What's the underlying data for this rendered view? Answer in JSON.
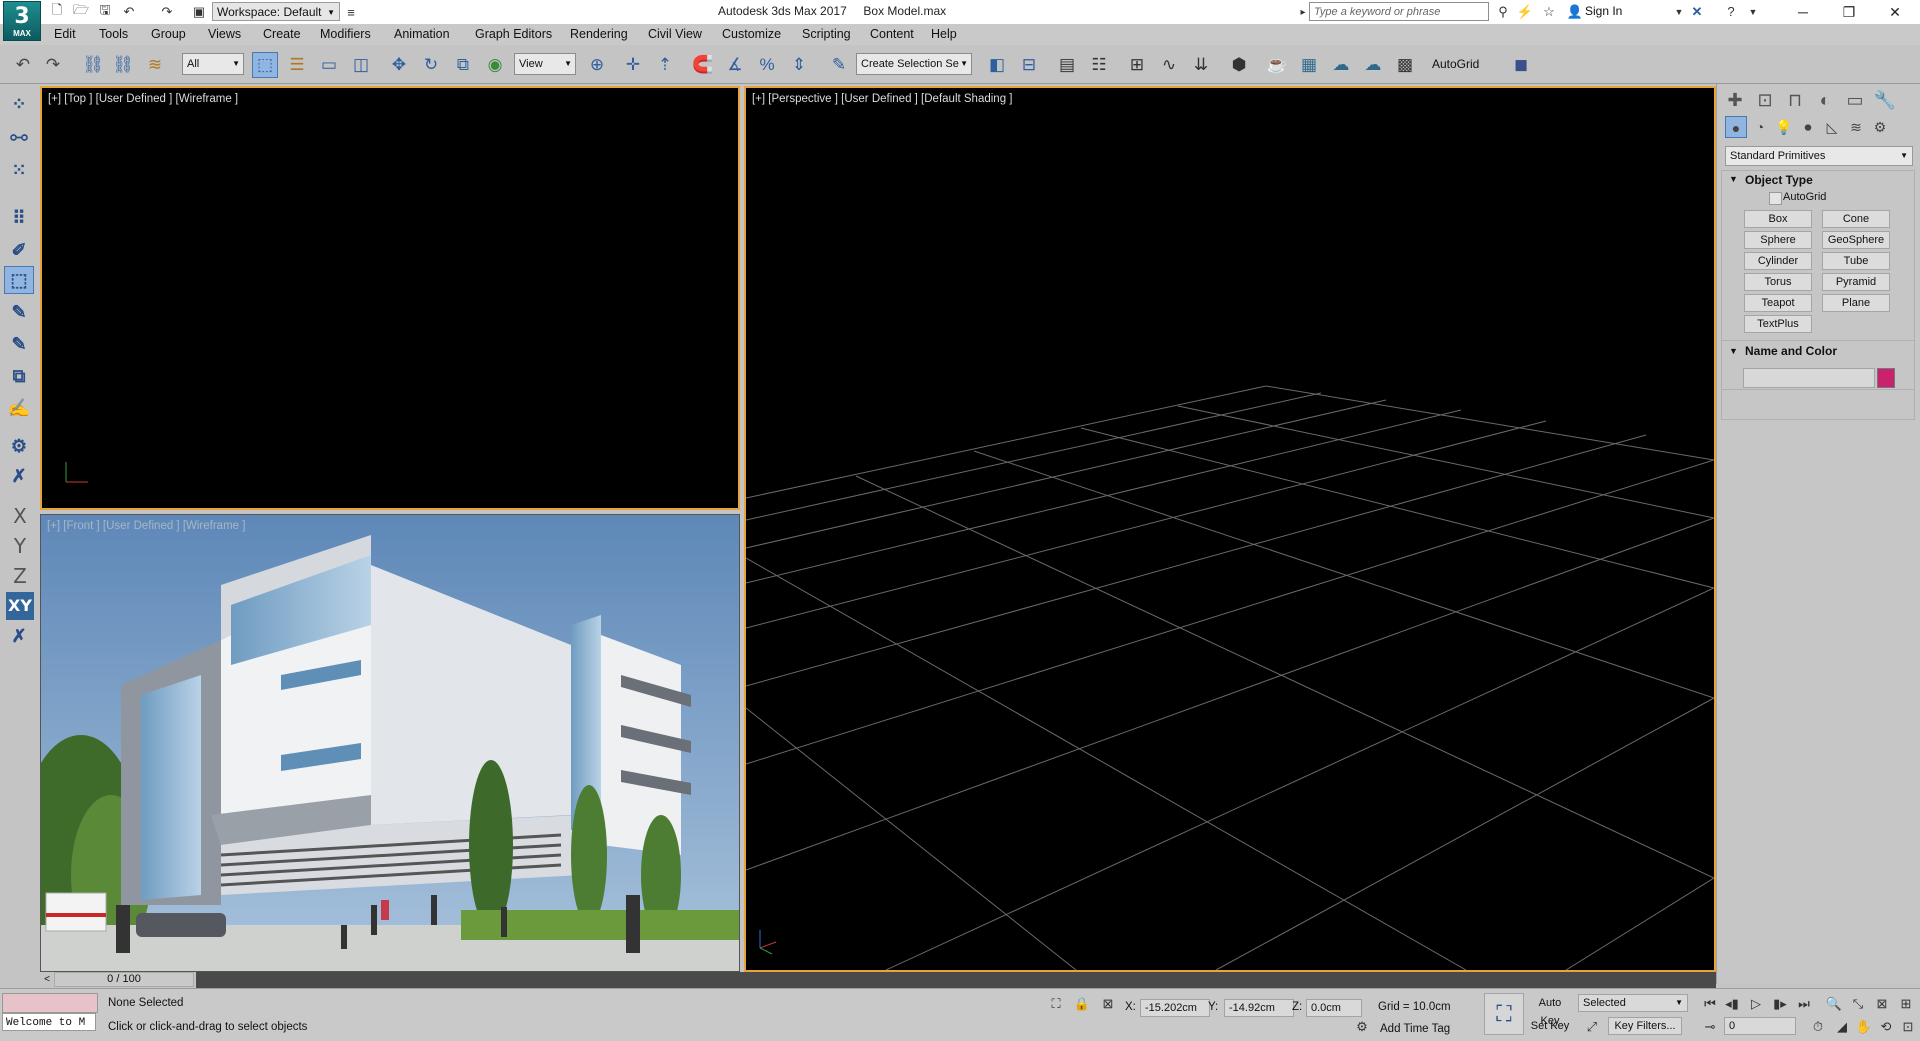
{
  "titlebar": {
    "logo_main": "3",
    "logo_sub": "MAX",
    "workspace": "Workspace: Default",
    "title": "Autodesk 3ds Max 2017     Box Model.max",
    "search_placeholder": "Type a keyword or phrase",
    "signin": "Sign In"
  },
  "menu": [
    "Edit",
    "Tools",
    "Group",
    "Views",
    "Create",
    "Modifiers",
    "Animation",
    "Graph Editors",
    "Rendering",
    "Civil View",
    "Customize",
    "Scripting",
    "Content",
    "Help"
  ],
  "toolbar": {
    "filter": "All",
    "ref_coord": "View",
    "named_selection": "Create Selection Se",
    "autogrid": "AutoGrid"
  },
  "left_axes": [
    "X",
    "Y",
    "Z",
    "XY"
  ],
  "viewports": {
    "top": "[+] [Top ] [User Defined ] [Wireframe ]",
    "front": "[+] [Front ] [User Defined ] [Wireframe ]",
    "perspective": "[+] [Perspective ] [User Defined ] [Default Shading ]"
  },
  "command_panel": {
    "category": "Standard Primitives",
    "object_type_header": "Object Type",
    "autogrid": "AutoGrid",
    "buttons": [
      "Box",
      "Cone",
      "Sphere",
      "GeoSphere",
      "Cylinder",
      "Tube",
      "Torus",
      "Pyramid",
      "Teapot",
      "Plane",
      "TextPlus"
    ],
    "name_color_header": "Name and Color",
    "color_swatch": "#c8236f"
  },
  "timeline": {
    "frame": "0 / 100"
  },
  "status": {
    "maxscript": "Welcome to M",
    "selection": "None Selected",
    "prompt": "Click or click-and-drag to select objects",
    "x_label": "X:",
    "x_value": "-15.202cm",
    "y_label": "Y:",
    "y_value": "-14.92cm",
    "z_label": "Z:",
    "z_value": "0.0cm",
    "grid": "Grid = 10.0cm",
    "add_time_tag": "Add Time Tag",
    "auto_key": "Auto Key",
    "set_key": "Set Key",
    "key_mode": "Selected",
    "key_filters": "Key Filters...",
    "current_frame": "0"
  }
}
